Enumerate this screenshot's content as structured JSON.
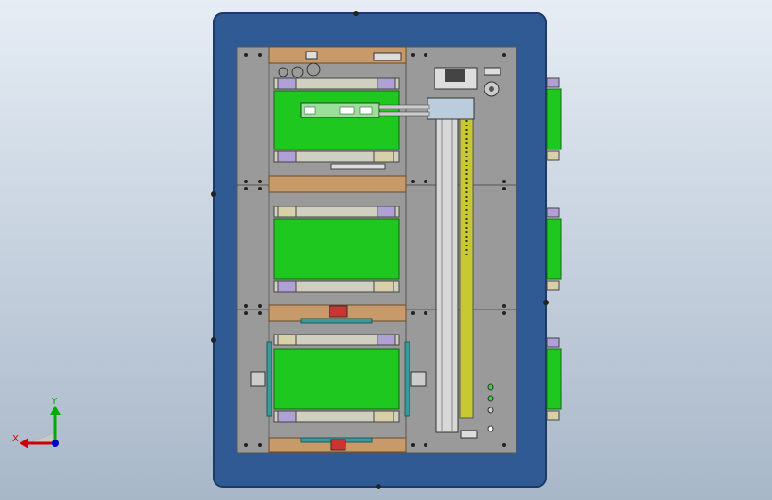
{
  "view": {
    "triad": {
      "x_label": "X",
      "y_label": "Y",
      "x_color": "#cc0000",
      "y_color": "#00aa00",
      "z_color": "#0000cc"
    },
    "colors": {
      "background_top": "#e6edf5",
      "background_bottom": "#a8b7c8",
      "outer_frame": "#2f5a93",
      "base_plate": "#9a9a9a",
      "conveyor_belt": "#1ec81e",
      "copper_bracket": "#c89a6a",
      "linear_rail": "#c8c832",
      "lavender_block": "#b0a0d8",
      "tan_block": "#d8d0a8",
      "teal_guide": "#3a9a9a"
    },
    "assembly": {
      "conveyor_modules": 3,
      "side_motors": 3,
      "indicator_lights": 3
    }
  }
}
